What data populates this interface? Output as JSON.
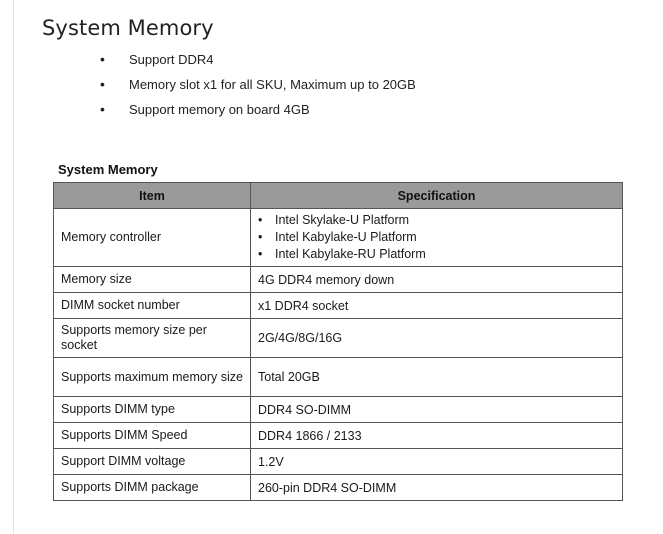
{
  "page": {
    "heading": "System Memory",
    "bullets": [
      "Support DDR4",
      "Memory slot x1 for all SKU, Maximum up to 20GB",
      "Support memory on board 4GB"
    ]
  },
  "table": {
    "title": "System Memory",
    "headers": {
      "item": "Item",
      "spec": "Specification"
    },
    "rows": [
      {
        "item": "Memory controller",
        "spec_list": [
          "Intel Skylake-U Platform",
          "Intel Kabylake-U Platform",
          "Intel Kabylake-RU Platform"
        ]
      },
      {
        "item": "Memory size",
        "spec": "4G DDR4 memory down"
      },
      {
        "item": "DIMM socket number",
        "spec": "x1 DDR4 socket"
      },
      {
        "item": "Supports memory size per socket",
        "spec": "2G/4G/8G/16G"
      },
      {
        "item": "Supports maximum memory size",
        "spec": "Total 20GB"
      },
      {
        "item": "Supports DIMM type",
        "spec": "DDR4 SO-DIMM"
      },
      {
        "item": "Supports DIMM Speed",
        "spec": "DDR4 1866 / 2133"
      },
      {
        "item": "Support DIMM voltage",
        "spec": "1.2V"
      },
      {
        "item": "Supports DIMM package",
        "spec": "260-pin DDR4 SO-DIMM"
      }
    ]
  }
}
